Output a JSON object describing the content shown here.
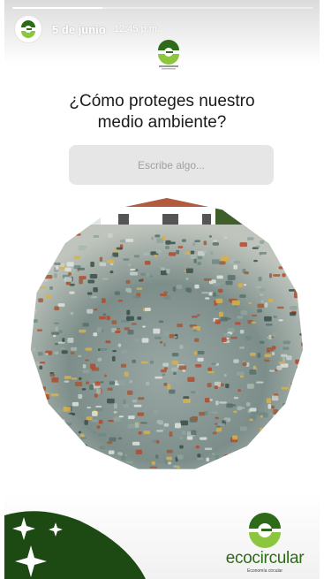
{
  "story": {
    "date": "5 de junio",
    "time": "12:45 p.m.",
    "progress": 0.3
  },
  "question": {
    "line1": "¿Cómo proteges nuestro",
    "line2": "medio ambiente?"
  },
  "answer": {
    "placeholder": "Escribe algo..."
  },
  "brand": {
    "name": "ecocircular",
    "tagline": "Economía circular"
  },
  "colors": {
    "brand_green": "#2e6b18",
    "light_green": "#8cc63f",
    "dark_green": "#1c4a12"
  },
  "icons": {
    "avatar": "ecocircular-logo-icon",
    "sparkles": "sparkle-icon"
  }
}
